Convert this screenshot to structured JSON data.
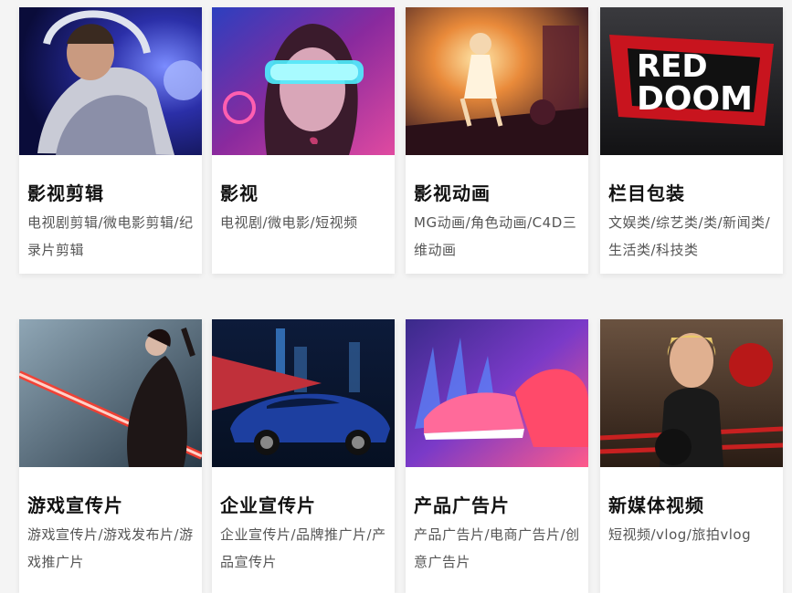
{
  "cards": [
    {
      "title": "影视剪辑",
      "desc": "电视剧剪辑/微电影剪辑/纪录片剪辑",
      "image_icon": "astronaut-photo-icon"
    },
    {
      "title": "影视",
      "desc": "电视剧/微电影/短视频",
      "image_icon": "neon-visor-woman-photo-icon"
    },
    {
      "title": "影视动画",
      "desc": "MG动画/角色动画/C4D三维动画",
      "image_icon": "animated-girl-scene-icon"
    },
    {
      "title": "栏目包装",
      "desc": "文娱类/综艺类/类/新闻类/生活类/科技类",
      "image_icon": "red-doom-logo-icon",
      "logo_lines": [
        "RED",
        "DOOM"
      ]
    },
    {
      "title": "游戏宣传片",
      "desc": "游戏宣传片/游戏发布片/游戏推广片",
      "image_icon": "warrior-lightsaber-icon"
    },
    {
      "title": "企业宣传片",
      "desc": "企业宣传片/品牌推广片/产品宣传片",
      "image_icon": "blue-sedan-photo-icon"
    },
    {
      "title": "产品广告片",
      "desc": "产品广告片/电商广告片/创意广告片",
      "image_icon": "sneaker-render-icon"
    },
    {
      "title": "新媒体视频",
      "desc": "短视频/vlog/旅拍vlog",
      "image_icon": "boxer-woman-photo-icon"
    }
  ]
}
